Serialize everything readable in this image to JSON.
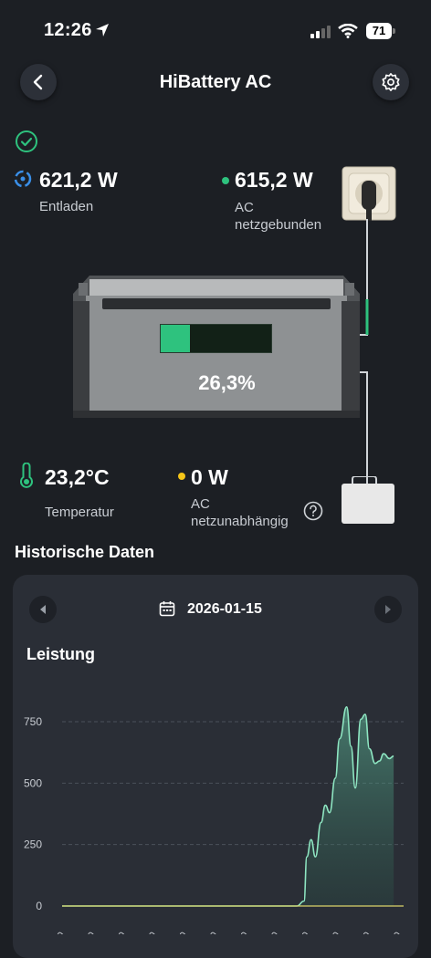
{
  "status_bar": {
    "time": "12:26",
    "battery": "71"
  },
  "header": {
    "title": "HiBattery AC"
  },
  "metrics": {
    "discharge": {
      "value": "621,2 W",
      "label": "Entladen"
    },
    "grid": {
      "value": "615,2 W",
      "label_line1": "AC",
      "label_line2": "netzgebunden",
      "dot_color": "#2ec27e"
    },
    "battery_level": {
      "value": "26,3%",
      "fraction": 0.263
    },
    "temperature": {
      "value": "23,2°C",
      "label": "Temperatur"
    },
    "offgrid": {
      "value": "0 W",
      "label_line1": "AC",
      "label_line2": "netzunabhängig",
      "dot_color": "#f5c518"
    }
  },
  "history": {
    "title": "Historische Daten",
    "date": "2026-01-15"
  },
  "chart_data": {
    "type": "area",
    "title": "Leistung",
    "yticks": [
      0,
      250,
      500,
      750
    ],
    "ylim": [
      0,
      860
    ],
    "xlim": [
      0,
      24
    ],
    "series": [
      {
        "x": [
          0,
          16.5,
          17.0,
          17.2,
          17.5,
          17.8,
          18.2,
          18.5,
          18.8,
          19.2,
          19.5,
          20.0,
          20.3,
          20.6,
          21.0,
          21.3,
          21.6,
          22.0,
          22.3,
          22.6,
          23.0,
          23.3
        ],
        "values": [
          0,
          0,
          20,
          200,
          270,
          200,
          340,
          410,
          380,
          520,
          680,
          810,
          650,
          480,
          760,
          780,
          640,
          580,
          590,
          620,
          600,
          610
        ]
      }
    ],
    "grid": true
  },
  "colors": {
    "accent": "#2ec27e",
    "line": "#8ee6c2",
    "baseline": "#d9d36a"
  }
}
